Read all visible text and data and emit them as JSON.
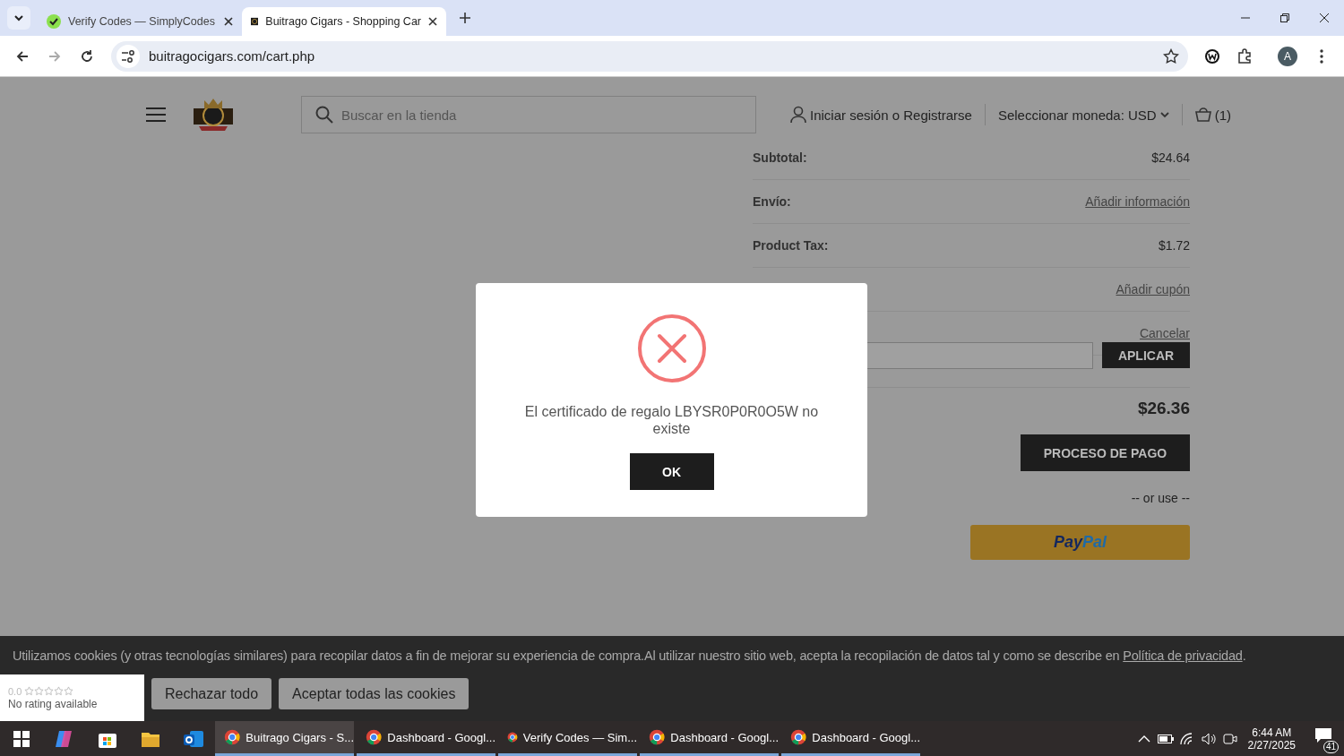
{
  "browser": {
    "tabs": [
      {
        "title": "Verify Codes — SimplyCodes",
        "selected": false,
        "kind": "green"
      },
      {
        "title": "Buitrago Cigars - Shopping Car",
        "selected": true,
        "kind": "logo"
      }
    ],
    "url": "buitragocigars.com/cart.php",
    "profile": "A"
  },
  "header": {
    "search_placeholder": "Buscar en la tienda",
    "account": "Iniciar sesión o Registrarse",
    "currency": "Seleccionar moneda: USD",
    "cart_count": "(1)"
  },
  "cart": {
    "rows": [
      {
        "kind": "value",
        "label": "Subtotal:",
        "value": "$24.64"
      },
      {
        "kind": "link",
        "label": "Envío:",
        "value": "Añadir información"
      },
      {
        "kind": "value",
        "label": "Product Tax:",
        "value": "$1.72"
      },
      {
        "kind": "link",
        "value": "Añadir cupón"
      },
      {
        "kind": "link",
        "value": "Cancelar"
      }
    ],
    "apply_button": "APLICAR",
    "total": "$26.36",
    "checkout_button": "PROCESO DE PAGO",
    "or_use": "-- or use --",
    "paypal": [
      "Pay",
      "Pal"
    ]
  },
  "modal": {
    "message": "El certificado de regalo LBYSR0P0R0O5W no existe",
    "ok_button": "OK"
  },
  "cookie_banner": {
    "text": "Utilizamos cookies (y otras tecnologías similares) para recopilar datos a fin de mejorar su experiencia de compra.Al utilizar nuestro sitio web, acepta la recopilación de datos tal y como se describe en ",
    "link": "Política de privacidad",
    "end": ".",
    "buttons": [
      "Rechazar todo",
      "Aceptar todas las cookies"
    ]
  },
  "rating_widget": {
    "score": "0.0",
    "stars": 0,
    "caption": "No rating available"
  },
  "taskbar": {
    "apps": [
      {
        "title": "Buitrago Cigars - S...",
        "selected": true
      },
      {
        "title": "Dashboard - Googl...",
        "selected": false
      },
      {
        "title": "Verify Codes — Sim...",
        "selected": false
      },
      {
        "title": "Dashboard - Googl...",
        "selected": false
      },
      {
        "title": "Dashboard - Googl...",
        "selected": false
      }
    ],
    "time": "6:44 AM",
    "date": "2/27/2025",
    "notifications": "41"
  }
}
